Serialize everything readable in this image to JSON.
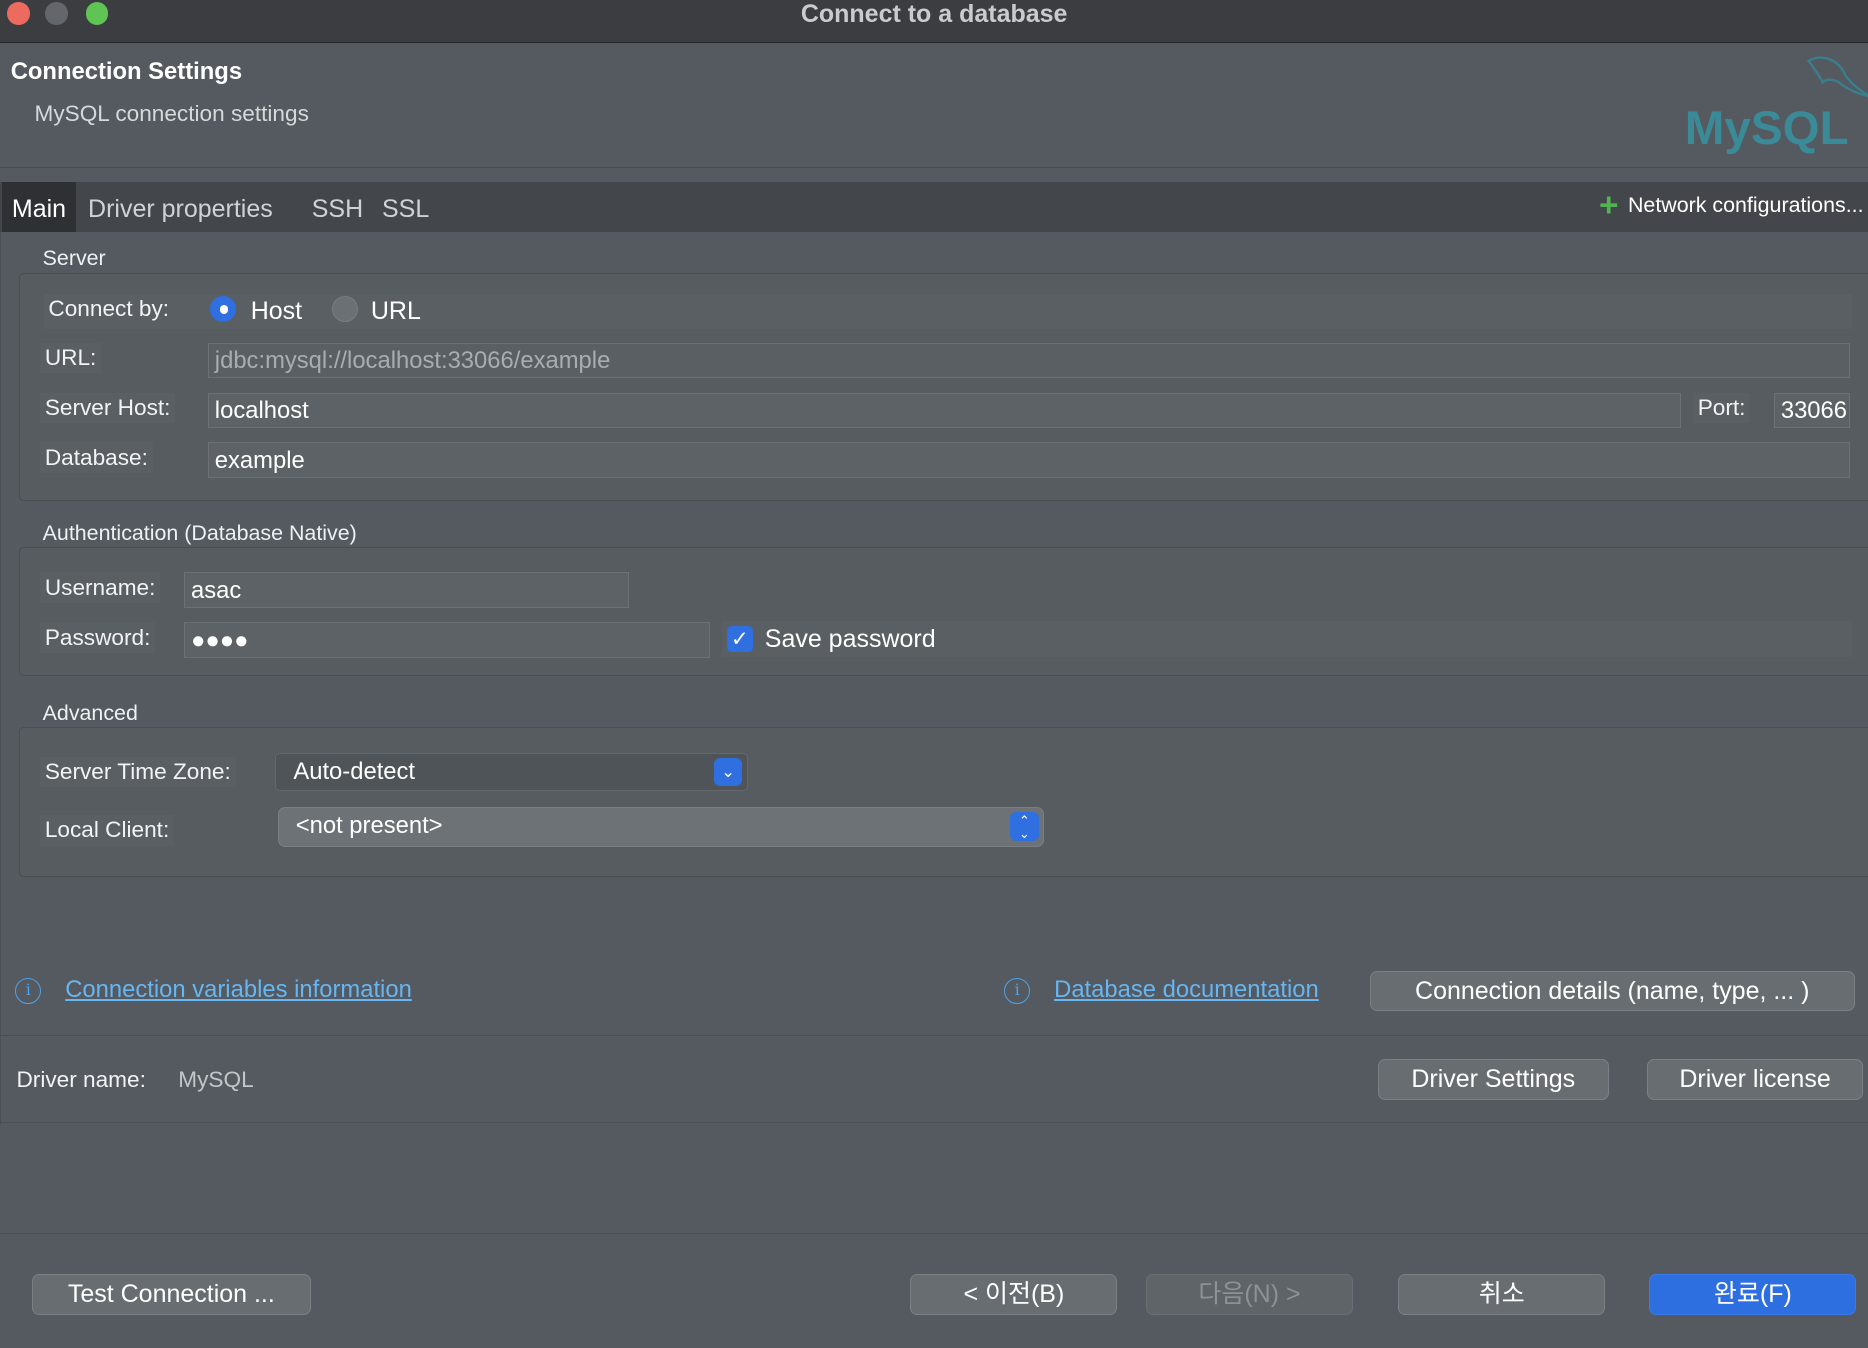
{
  "window": {
    "title": "Connect to a database"
  },
  "header": {
    "title": "Connection Settings",
    "subtitle": "MySQL connection settings",
    "logo_text": "MySQL"
  },
  "tabs": [
    {
      "label": "Main",
      "active": true
    },
    {
      "label": "Driver properties",
      "active": false
    },
    {
      "label": "SSH",
      "active": false
    },
    {
      "label": "SSL",
      "active": false
    }
  ],
  "network_config": {
    "label": "Network configurations..."
  },
  "server": {
    "section_label": "Server",
    "connect_by_label": "Connect by:",
    "connect_by_options": [
      "Host",
      "URL"
    ],
    "connect_by_selected": "Host",
    "url_label": "URL:",
    "url_value": "jdbc:mysql://localhost:33066/example",
    "host_label": "Server Host:",
    "host_value": "localhost",
    "port_label": "Port:",
    "port_value": "33066",
    "database_label": "Database:",
    "database_value": "example"
  },
  "auth": {
    "section_label": "Authentication (Database Native)",
    "username_label": "Username:",
    "username_value": "asac",
    "password_label": "Password:",
    "password_value": "●●●●",
    "save_password_label": "Save password",
    "save_password_checked": true
  },
  "advanced": {
    "section_label": "Advanced",
    "timezone_label": "Server Time Zone:",
    "timezone_value": "Auto-detect",
    "local_client_label": "Local Client:",
    "local_client_value": "<not present>"
  },
  "links": {
    "conn_vars": "Connection variables information",
    "db_docs": "Database documentation",
    "conn_details_button": "Connection details (name, type, ... )"
  },
  "driver": {
    "name_label": "Driver name:",
    "name_value": "MySQL",
    "settings_button": "Driver Settings",
    "license_button": "Driver license"
  },
  "footer": {
    "test_button": "Test Connection ...",
    "back_button": "< 이전(B)",
    "next_button": "다음(N) >",
    "cancel_button": "취소",
    "finish_button": "완료(F)"
  },
  "colors": {
    "accent": "#2f6fe0",
    "link": "#67b6f2",
    "background": "#545a5f"
  }
}
